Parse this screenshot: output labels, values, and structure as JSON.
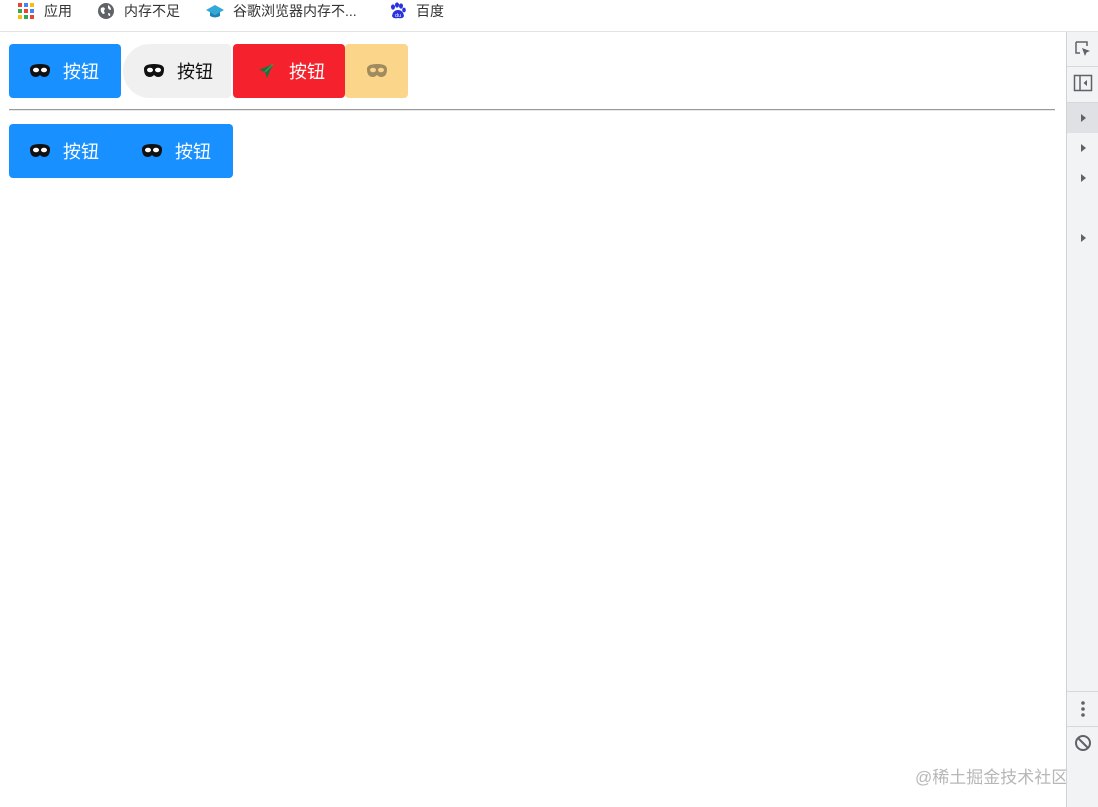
{
  "bookmarks": [
    {
      "label": "应用",
      "icon": "apps-grid-icon"
    },
    {
      "label": "内存不足",
      "icon": "globe-icon"
    },
    {
      "label": "谷歌浏览器内存不...",
      "icon": "graduation-cap-icon"
    },
    {
      "label": "百度",
      "icon": "baidu-paw-icon"
    }
  ],
  "row1": [
    {
      "label": "按钮",
      "icon": "mask-icon",
      "style": "primary",
      "color": "#1890ff"
    },
    {
      "label": "按钮",
      "icon": "mask-icon",
      "style": "default-round",
      "color": "#f0f0f0"
    },
    {
      "label": "按钮",
      "icon": "send-icon",
      "style": "danger",
      "color": "#f5222d"
    },
    {
      "label": "",
      "icon": "mask-icon",
      "style": "warning-icon-only",
      "color": "#fbd589"
    }
  ],
  "row2": [
    {
      "label": "按钮",
      "icon": "mask-icon",
      "color": "#1890ff"
    },
    {
      "label": "按钮",
      "icon": "mask-icon",
      "color": "#1890ff"
    }
  ],
  "devtools": {
    "icons": [
      "element-picker-icon",
      "dock-side-icon",
      "more-vertical-icon",
      "block-icon"
    ],
    "tree_arrows": 4
  },
  "watermark": "@稀土掘金技术社区"
}
